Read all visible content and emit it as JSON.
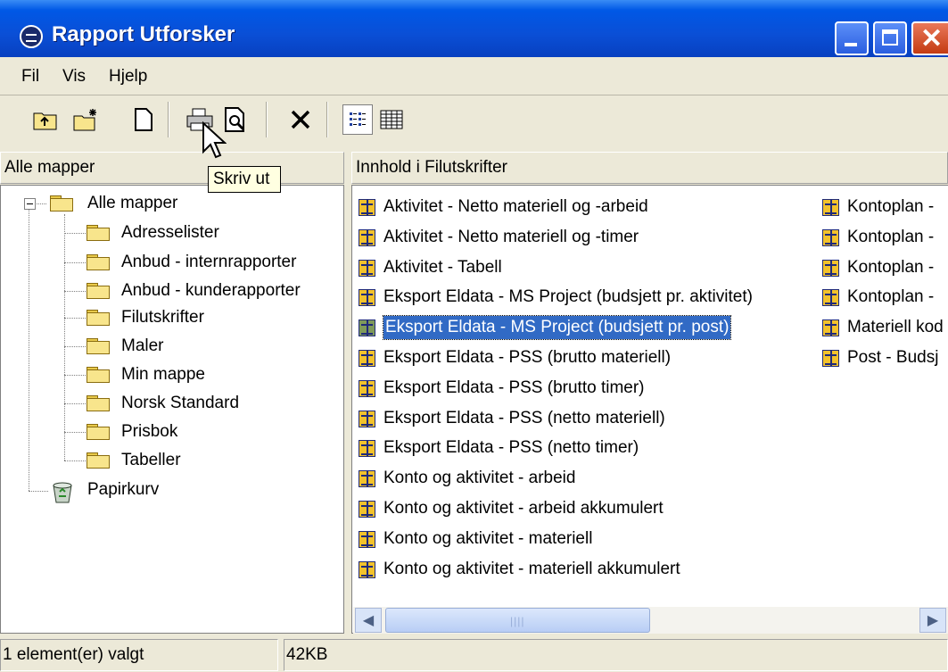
{
  "window": {
    "title": "Rapport Utforsker"
  },
  "menu": {
    "items": [
      "Fil",
      "Vis",
      "Hjelp"
    ]
  },
  "tooltip": "Skriv ut",
  "tree_pane": {
    "header": "Alle mapper",
    "root": "Alle mapper",
    "children": [
      "Adresselister",
      "Anbud - internrapporter",
      "Anbud - kunderapporter",
      "Filutskrifter",
      "Maler",
      "Min mappe",
      "Norsk Standard",
      "Prisbok",
      "Tabeller"
    ],
    "recycle": "Papirkurv"
  },
  "list_pane": {
    "header": "Innhold i Filutskrifter",
    "column1": [
      "Aktivitet - Netto materiell og -arbeid",
      "Aktivitet - Netto materiell og -timer",
      "Aktivitet - Tabell",
      "Eksport Eldata - MS Project (budsjett pr. aktivitet)",
      "Eksport Eldata - MS Project (budsjett pr. post)",
      "Eksport Eldata - PSS (brutto materiell)",
      "Eksport Eldata - PSS (brutto timer)",
      "Eksport Eldata - PSS (netto materiell)",
      "Eksport Eldata - PSS (netto timer)",
      "Konto og aktivitet - arbeid",
      "Konto og aktivitet - arbeid akkumulert",
      "Konto og aktivitet - materiell",
      "Konto og aktivitet - materiell akkumulert"
    ],
    "column2": [
      "Kontoplan -",
      "Kontoplan -",
      "Kontoplan -",
      "Kontoplan -",
      "Materiell kod",
      "Post - Budsj"
    ],
    "selected": "Eksport Eldata - MS Project (budsjett pr. post)"
  },
  "status": {
    "selection": "1 element(er) valgt",
    "size": "42KB"
  },
  "colors": {
    "titlebar": "#0a4fd6",
    "selection": "#316ac5",
    "window_bg": "#ece9d8"
  }
}
